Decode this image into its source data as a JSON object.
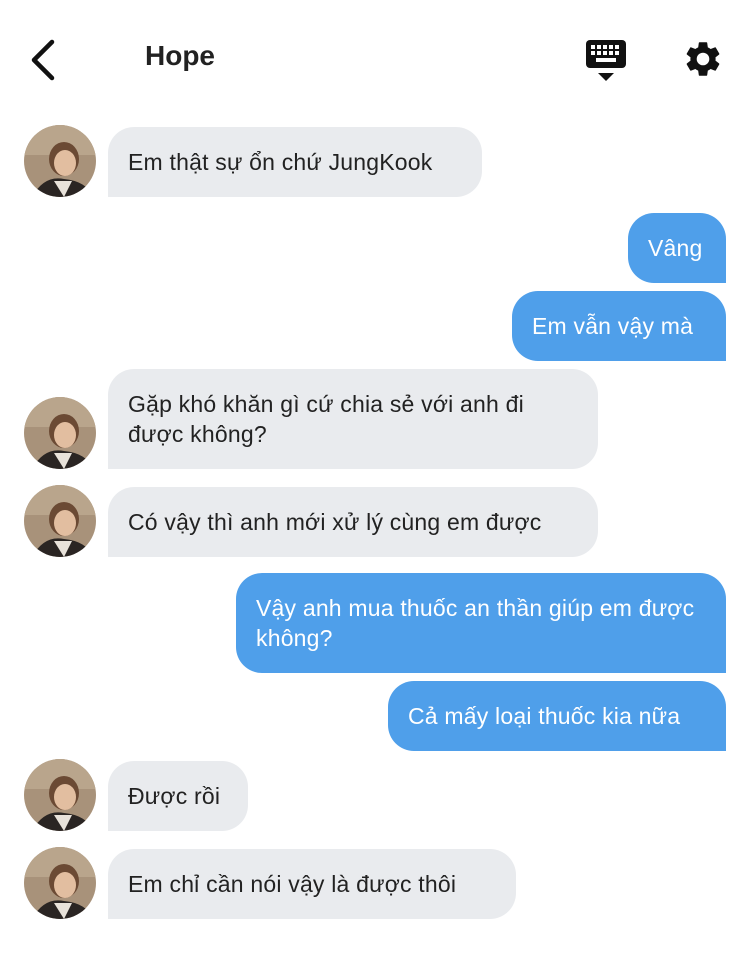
{
  "header": {
    "title": "Hope",
    "back_icon": "chevron-left-icon",
    "keyboard_icon": "keyboard-hide-icon",
    "settings_icon": "gear-icon"
  },
  "colors": {
    "incoming_bubble": "#e9ebee",
    "outgoing_bubble": "#4f9fea"
  },
  "messages": [
    {
      "from": "other",
      "text": "Em thật sự ổn chứ JungKook"
    },
    {
      "from": "me",
      "text": "Vâng"
    },
    {
      "from": "me",
      "text": "Em vẫn vậy mà"
    },
    {
      "from": "other",
      "text": "Gặp khó khăn gì cứ chia sẻ với anh đi được không?"
    },
    {
      "from": "other",
      "text": "Có vậy thì anh mới xử lý cùng em được"
    },
    {
      "from": "me",
      "text": "Vậy anh mua thuốc an thần giúp em được không?"
    },
    {
      "from": "me",
      "text": "Cả mấy loại thuốc kia nữa"
    },
    {
      "from": "other",
      "text": "Được rồi"
    },
    {
      "from": "other",
      "text": "Em chỉ cần nói vậy là được thôi"
    }
  ]
}
